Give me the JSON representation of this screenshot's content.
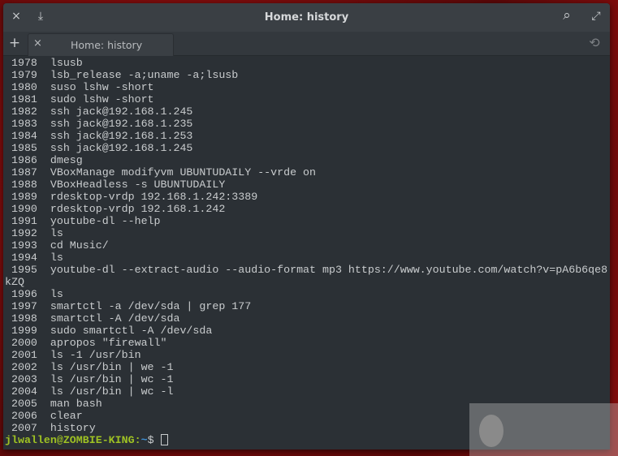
{
  "window": {
    "title": "Home: history"
  },
  "titlebar": {
    "close_icon": "×",
    "download_icon": "⤓",
    "search_icon": "⌕",
    "fullscreen_icon": "⤢"
  },
  "tabbar": {
    "new_tab": "+",
    "tab": {
      "label": "Home: history",
      "close": "×"
    },
    "history_icon": "⟲"
  },
  "terminal": {
    "lines": [
      " 1978  lsusb",
      " 1979  lsb_release -a;uname -a;lsusb",
      " 1980  suso lshw -short",
      " 1981  sudo lshw -short",
      " 1982  ssh jack@192.168.1.245",
      " 1983  ssh jack@192.168.1.235",
      " 1984  ssh jack@192.168.1.253",
      " 1985  ssh jack@192.168.1.245",
      " 1986  dmesg",
      " 1987  VBoxManage modifyvm UBUNTUDAILY --vrde on",
      " 1988  VBoxHeadless -s UBUNTUDAILY",
      " 1989  rdesktop-vrdp 192.168.1.242:3389",
      " 1990  rdesktop-vrdp 192.168.1.242",
      " 1991  youtube-dl --help",
      " 1992  ls",
      " 1993  cd Music/",
      " 1994  ls",
      " 1995  youtube-dl --extract-audio --audio-format mp3 https://www.youtube.com/watch?v=pA6b6qe8",
      "kZQ",
      " 1996  ls",
      " 1997  smartctl -a /dev/sda | grep 177",
      " 1998  smartctl -A /dev/sda",
      " 1999  sudo smartctl -A /dev/sda",
      " 2000  apropos \"firewall\"",
      " 2001  ls -1 /usr/bin",
      " 2002  ls /usr/bin | we -1",
      " 2003  ls /usr/bin | wc -1",
      " 2004  ls /usr/bin | wc -l",
      " 2005  man bash",
      " 2006  clear",
      " 2007  history"
    ],
    "prompt": {
      "user": "jlwallen@ZOMBIE-KING",
      "sep": ":",
      "path": "~",
      "symbol": "$ "
    }
  }
}
